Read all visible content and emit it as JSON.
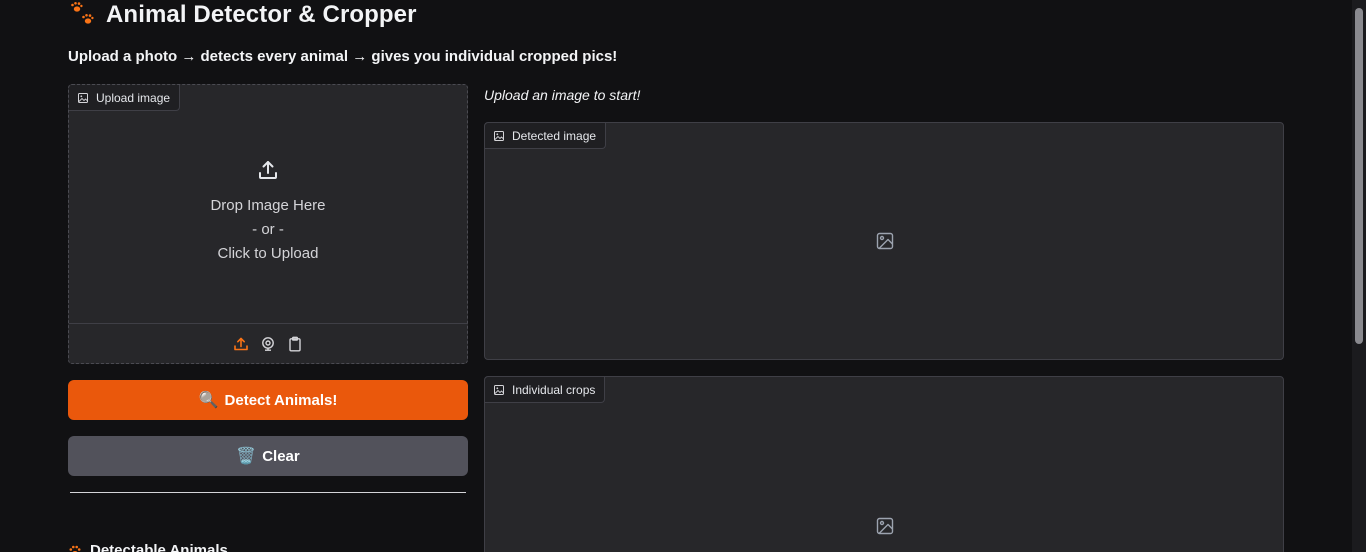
{
  "header": {
    "title": "Animal Detector & Cropper",
    "subtitle": "Upload a photo → detects every animal → gives you individual cropped pics!"
  },
  "upload": {
    "label": "Upload image",
    "drop_text": "Drop Image Here",
    "or_text": "- or -",
    "click_text": "Click to Upload",
    "toolbar_icons": [
      "upload-icon",
      "webcam-icon",
      "clipboard-icon"
    ]
  },
  "buttons": {
    "detect_emoji": "🔍",
    "detect_label": "Detect Animals!",
    "clear_emoji": "🗑️",
    "clear_label": "Clear"
  },
  "status": {
    "message": "Upload an image to start!"
  },
  "outputs": {
    "detected_label": "Detected image",
    "crops_label": "Individual crops"
  },
  "sections": {
    "detectable_heading": "Detectable Animals"
  },
  "colors": {
    "accent": "#ea580c",
    "secondary": "#52525b",
    "panel": "#27272a",
    "background": "#111113"
  }
}
